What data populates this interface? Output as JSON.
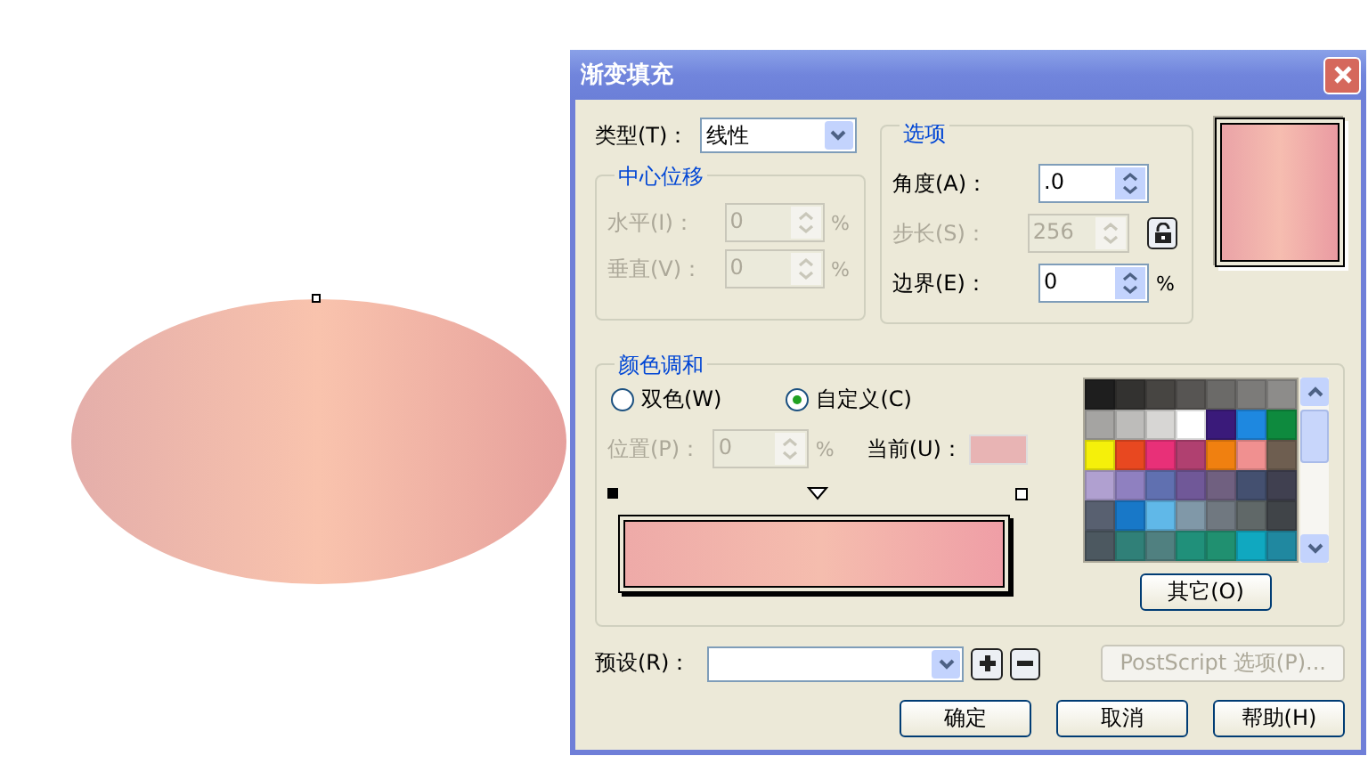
{
  "window": {
    "title": "渐变填充"
  },
  "type": {
    "label": "类型(T)：",
    "value": "线性"
  },
  "center_offset": {
    "title": "中心位移",
    "fields": [
      {
        "label": "水平(I)：",
        "value": "0",
        "unit": "%",
        "disabled": true
      },
      {
        "label": "垂直(V)：",
        "value": "0",
        "unit": "%",
        "disabled": true
      }
    ]
  },
  "options": {
    "title": "选项",
    "fields": [
      {
        "label": "角度(A)：",
        "value": ".0",
        "disabled": false,
        "lock": false
      },
      {
        "label": "步长(S)：",
        "value": "256",
        "disabled": true,
        "lock": true
      },
      {
        "label": "边界(E)：",
        "value": "0",
        "unit": "%",
        "disabled": false,
        "lock": false
      }
    ]
  },
  "color_blend": {
    "title": "颜色调和",
    "modes": [
      {
        "label": "双色(W)",
        "selected": false
      },
      {
        "label": "自定义(C)",
        "selected": true
      }
    ],
    "position": {
      "label": "位置(P)：",
      "value": "0",
      "unit": "%",
      "disabled": true
    },
    "current": {
      "label": "当前(U)：",
      "color": "#e8b4b4"
    },
    "palette": [
      {
        "color": "#1e1e1e"
      },
      {
        "color": "#333230"
      },
      {
        "color": "#474542"
      },
      {
        "color": "#575553"
      },
      {
        "color": "#6b6a68"
      },
      {
        "color": "#7c7b79"
      },
      {
        "color": "#8d8c8a"
      },
      {
        "color": "#a5a4a2"
      },
      {
        "color": "#bdbcba"
      },
      {
        "color": "#d7d6d4"
      },
      {
        "color": "#ffffff"
      },
      {
        "color": "#3a1a7a"
      },
      {
        "color": "#1e88e0"
      },
      {
        "color": "#0e8a3e"
      },
      {
        "color": "#f5f00a"
      },
      {
        "color": "#e84820"
      },
      {
        "color": "#e83078"
      },
      {
        "color": "#b04070"
      },
      {
        "color": "#f08010"
      },
      {
        "color": "#f09090"
      },
      {
        "color": "#6e5e50"
      },
      {
        "color": "#b0a0d0"
      },
      {
        "color": "#8f80c0"
      },
      {
        "color": "#6070b0"
      },
      {
        "color": "#705898"
      },
      {
        "color": "#706080"
      },
      {
        "color": "#445070"
      },
      {
        "color": "#404050"
      },
      {
        "color": "#586070"
      },
      {
        "color": "#1878c8"
      },
      {
        "color": "#60b8e8"
      },
      {
        "color": "#8098a8"
      },
      {
        "color": "#707880"
      },
      {
        "color": "#606868"
      },
      {
        "color": "#404448"
      },
      {
        "color": "#4c5860"
      },
      {
        "color": "#308078"
      },
      {
        "color": "#508080"
      },
      {
        "color": "#20907a"
      },
      {
        "color": "#209070"
      },
      {
        "color": "#10a8c0"
      },
      {
        "color": "#2088a0"
      }
    ],
    "other_button": "其它(O)"
  },
  "preset": {
    "label": "预设(R)："
  },
  "postscript_button": {
    "label": "PostScript 选项(P)...",
    "disabled": true
  },
  "buttons": [
    "确定",
    "取消",
    "帮助(H)"
  ]
}
